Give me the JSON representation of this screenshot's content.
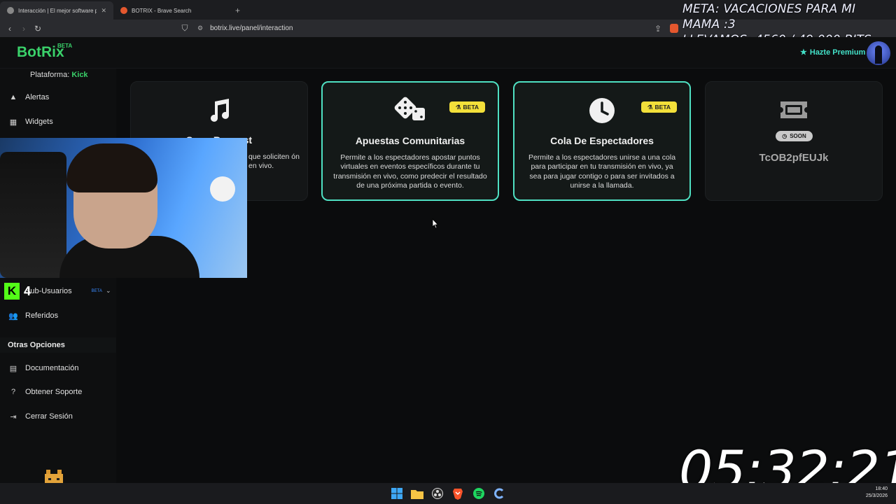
{
  "browser": {
    "tabs": [
      {
        "title": "Interacción | El mejor software p",
        "close": "✕"
      },
      {
        "title": "BOTRIX - Brave Search"
      }
    ],
    "new_tab": "+",
    "url": "botrix.live/panel/interaction"
  },
  "overlay": {
    "meta_line1": "META: VACACIONES PARA MI MAMA :3",
    "meta_line2": "LLEVAMOS: 4560 / 49.000 BITS",
    "timer": "05:32:21"
  },
  "header": {
    "logo": "BotRix",
    "logo_badge": "BETA",
    "premium": "Hazte Premium"
  },
  "sidebar": {
    "platform_label": "Plataforma:",
    "platform_value": "Kick",
    "items": [
      {
        "label": "Alertas",
        "icon": "warning-icon"
      },
      {
        "label": "Widgets",
        "icon": "grid-icon"
      },
      {
        "label": "Sub-Usuarios",
        "icon": "users-cog-icon",
        "badge": "BETA"
      },
      {
        "label": "Referidos",
        "icon": "users-icon"
      }
    ],
    "section_title": "Otras Opciones",
    "other_items": [
      {
        "label": "Documentación",
        "icon": "book-icon"
      },
      {
        "label": "Obtener Soporte",
        "icon": "question-icon"
      },
      {
        "label": "Cerrar Sesión",
        "icon": "logout-icon"
      }
    ]
  },
  "cards": [
    {
      "title": "Song Request",
      "desc": "que soliciten ón en vivo.",
      "icon": "music-icon"
    },
    {
      "title": "Apuestas Comunitarias",
      "desc": "Permite a los espectadores apostar puntos virtuales en eventos específicos durante tu transmisión en vivo, como predecir el resultado de una próxima partida o evento.",
      "badge": "BETA",
      "icon": "dice-icon"
    },
    {
      "title": "Cola De Espectadores",
      "desc": "Permite a los espectadores unirse a una cola para participar en tu transmisión en vivo, ya sea para jugar contigo o para ser invitados a unirse a la llamada.",
      "badge": "BETA",
      "icon": "clock-icon"
    },
    {
      "title": "TcOB2pfEUJk",
      "badge": "SOON",
      "icon": "ticket-icon"
    }
  ],
  "kick_overlay": {
    "logo": "K",
    "value": "4"
  },
  "taskbar": {
    "time": "18:40",
    "date": "25/3/2026"
  },
  "colors": {
    "brand": "#3ad16a",
    "accent": "#4fe0c2",
    "beta_badge": "#f3e03a"
  }
}
